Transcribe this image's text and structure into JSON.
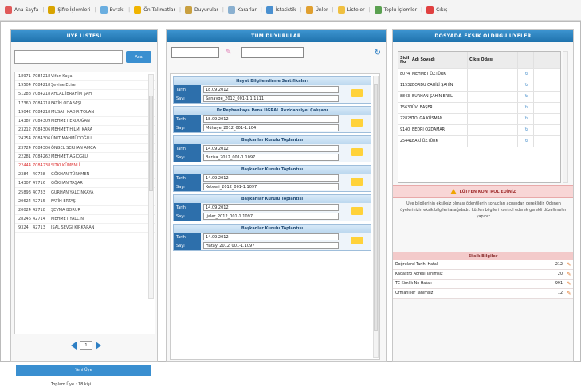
{
  "toolbar": {
    "items": [
      {
        "label": "Ana Sayfa",
        "icon": "home-icon",
        "color": "#e05a5a"
      },
      {
        "label": "Şifre İşlemleri",
        "icon": "key-icon",
        "color": "#d9a400"
      },
      {
        "label": "Evrakı",
        "icon": "document-icon",
        "color": "#6aaee0"
      },
      {
        "label": "Ön Talimatlar",
        "icon": "star-icon",
        "color": "#f0b400"
      },
      {
        "label": "Duyurular",
        "icon": "announcement-icon",
        "color": "#c9a040"
      },
      {
        "label": "Kararlar",
        "icon": "balance-icon",
        "color": "#8ab0d0"
      },
      {
        "label": "İstatistik",
        "icon": "chart-icon",
        "color": "#4a90d0"
      },
      {
        "label": "Ünler",
        "icon": "folder-icon",
        "color": "#e0a030"
      },
      {
        "label": "Listeler",
        "icon": "list-icon",
        "color": "#f0c040"
      },
      {
        "label": "Toplu İşlemler",
        "icon": "grid-icon",
        "color": "#5aa050"
      },
      {
        "label": "Çıkış",
        "icon": "exit-icon",
        "color": "#e04040"
      }
    ]
  },
  "left": {
    "title": "ÜYE LİSTESİ",
    "search_button": "Ara",
    "rows": [
      [
        "18971",
        "7084218",
        "Vifan Kaya"
      ],
      [
        "19504",
        "7084218",
        "Şevine Ecire"
      ],
      [
        "51288",
        "7084218",
        "AHLAL İBRAHİM ŞAHİ"
      ],
      [
        "17360",
        "7084218",
        "FATİH ODABAŞI"
      ],
      [
        "19042",
        "7084218",
        "MUSAH KADIR TOLAN"
      ],
      [
        "14387",
        "7084309",
        "MEHMET ERDOĞAN"
      ],
      [
        "23212",
        "7084306",
        "MEHMET HİLMİ KARA"
      ],
      [
        "24254",
        "7084306",
        "ÜNIT MAHMÜDOĞLU"
      ],
      [
        "23724",
        "7084306",
        "ÖNGEL SERHAN AMCA"
      ],
      [
        "22281",
        "7084262",
        "MEHMET AĞIOĞLU"
      ],
      [
        "22444",
        "7084238",
        "SITKI KÜMENLİ"
      ],
      [
        "2384",
        "40728",
        "GÖKHAN TÜRKMEN"
      ],
      [
        "14307",
        "47716",
        "GÖKHAN TAŞAR"
      ],
      [
        "25893",
        "40733",
        "GÜRHAN YALÇINKAYA"
      ],
      [
        "20624",
        "42715",
        "FATİH ERTAŞ"
      ],
      [
        "20024",
        "42718",
        "ŞEVMA BORUR"
      ],
      [
        "28246",
        "42714",
        "MEHMET YALCİN"
      ],
      [
        "9324",
        "42713",
        "İŞAL SEVGİ KIRKARAN"
      ]
    ],
    "page": "1",
    "button": "Yeni Üye",
    "footer": "Toplam Üye : 18 kişi"
  },
  "mid": {
    "title": "TÜM DUYURULAR",
    "labels": {
      "date": "Tarih",
      "number": "Sayı"
    },
    "cards": [
      {
        "title": "Hayat Bilgilendirme Sertifikaları",
        "date": "18.09.2012",
        "number": "Sanayge_2012_001-1.1.1111"
      },
      {
        "title": "Dr.Reyhankaya Pena UĞRAL Rezidansiyel Çalışanı",
        "date": "18.09.2012",
        "number": "Mühaye_2012_001-1.104"
      },
      {
        "title": "Başkanlar Kurulu Toplantısı",
        "date": "14.09.2012",
        "number": "Barisa_2012_001-1.1097"
      },
      {
        "title": "Başkanlar Kurulu Toplantısı",
        "date": "14.09.2012",
        "number": "Keteeri_2012_001-1.1097"
      },
      {
        "title": "Başkanlar Kurulu Toplantısı",
        "date": "14.09.2012",
        "number": "Ijaler_2012_001-1.1097"
      },
      {
        "title": "Başkanlar Kurulu Toplantısı",
        "date": "14.09.2012",
        "number": "Hatay_2012_001-1.1097"
      }
    ]
  },
  "right": {
    "title": "DOSYADA EKSİK OLDUĞU ÜYELER",
    "cols": [
      "Sicil No",
      "Adı Soyadı",
      "Çıkış Odası",
      ""
    ],
    "rows": [
      [
        "8074",
        "MEHMET ÖZTÜRK",
        ""
      ],
      [
        "11532",
        "BORDU CAHİLİ ŞAHİN",
        ""
      ],
      [
        "8843",
        "BURHAN ŞAHİN EREL",
        ""
      ],
      [
        "15630",
        "ÜVİ BAŞER",
        ""
      ],
      [
        "22828",
        "TOLGA KÜSMAN",
        ""
      ],
      [
        "9140",
        "BEDRİ ÖZDAMAR",
        ""
      ],
      [
        "25441",
        "BAKİ ÖZTÜRK",
        ""
      ]
    ],
    "warning": "LÜTFEN KONTROL EDİNİZ",
    "warning_text": "Üye bilgilerinin eksiksiz olması ödentilerin sonuçları açısından gereklidir. Ödenen üyelerinizin eksik bilgileri aşağıdadır. Lütfen bilgileri kontrol ederek gerekli düzeltmeleri yapınız.",
    "missing_title": "Eksik Bilgiler",
    "missing": [
      {
        "label": "Doğrulanıl Tarihi Hatalı",
        "count": "212"
      },
      {
        "label": "Kadastro Adresi Tanımsız",
        "count": "20"
      },
      {
        "label": "TC Kimlik No Hatalı",
        "count": "991"
      },
      {
        "label": "Ormanlıler Tanımsız",
        "count": "12"
      }
    ]
  }
}
